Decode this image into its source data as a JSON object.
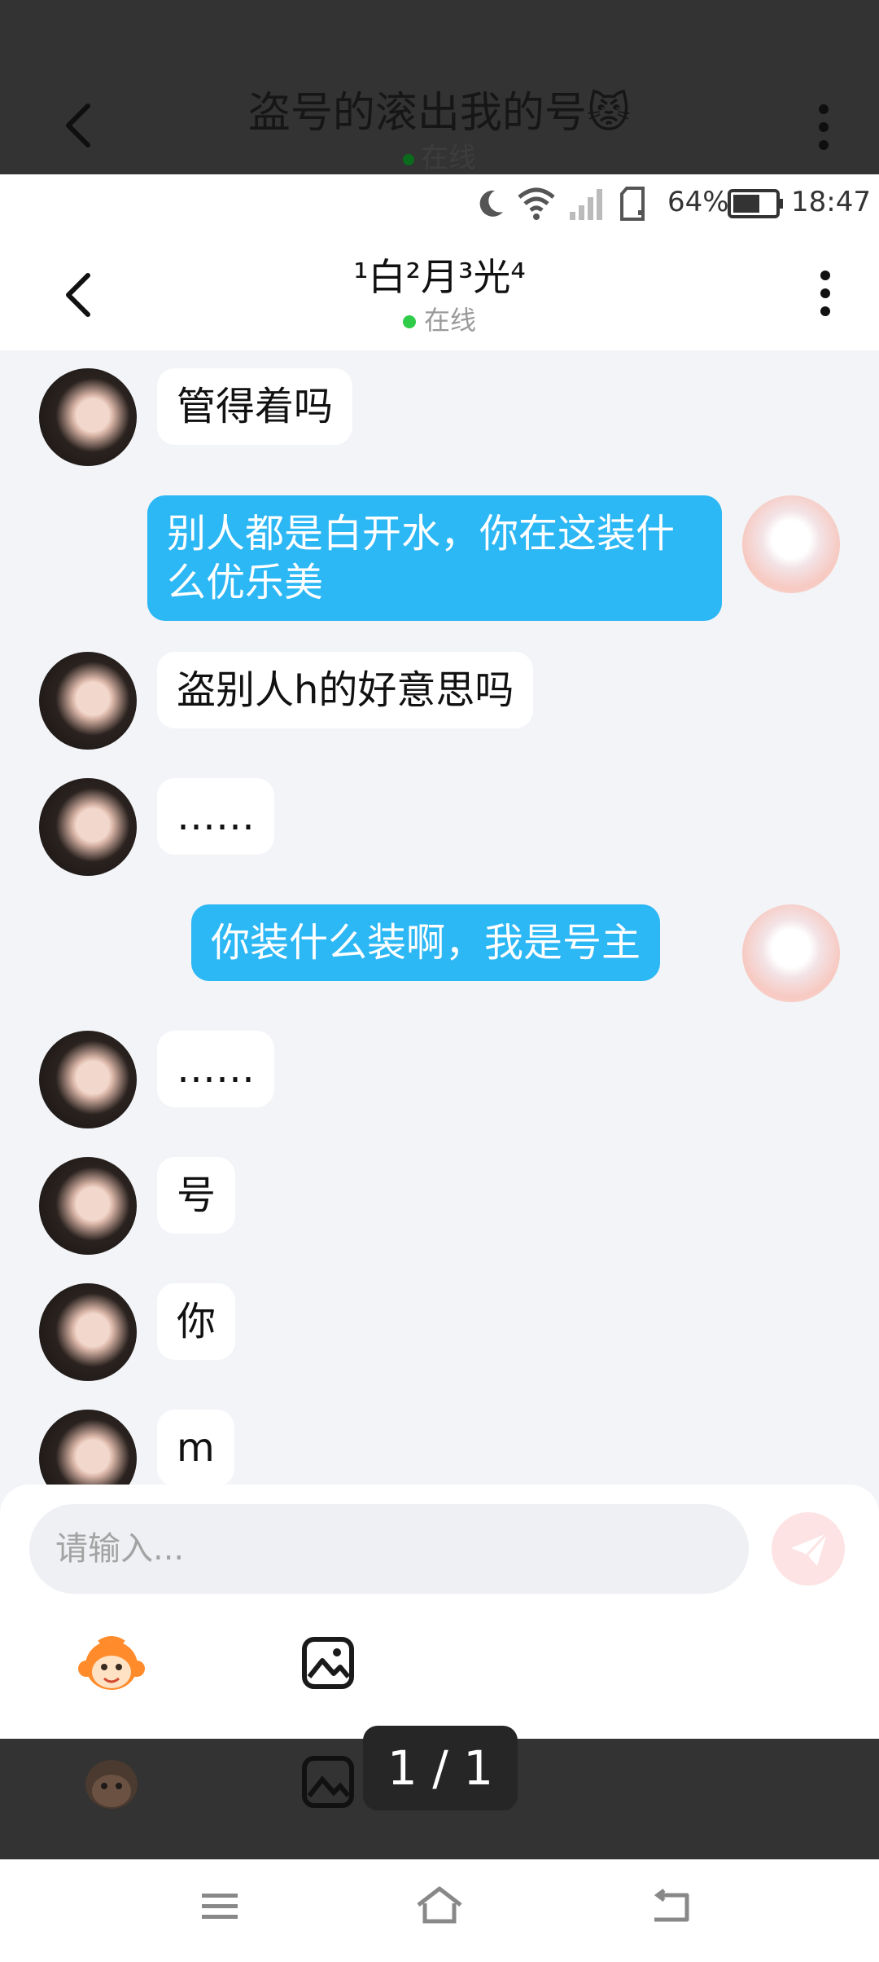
{
  "overlay": {
    "title": "盗号的滚出我的号😾",
    "status": "在线"
  },
  "status_bar": {
    "battery": "64%",
    "time": "18:47"
  },
  "header": {
    "title": "¹白²月³光⁴",
    "status": "在线"
  },
  "messages": [
    {
      "side": "in",
      "text": "管得着吗"
    },
    {
      "side": "out",
      "text": "别人都是白开水，你在这装什么优乐美"
    },
    {
      "side": "in",
      "text": "盗别人h的好意思吗"
    },
    {
      "side": "in",
      "text": "……"
    },
    {
      "side": "out",
      "text": "你装什么装啊，我是号主"
    },
    {
      "side": "in",
      "text": "……"
    },
    {
      "side": "in",
      "text": "号"
    },
    {
      "side": "in",
      "text": "你"
    },
    {
      "side": "in",
      "text": "m"
    }
  ],
  "input": {
    "placeholder": "请输入..."
  },
  "page_indicator": "1 / 1",
  "icons": {
    "back": "chevron-left-icon",
    "more": "more-vertical-icon",
    "moon": "moon-icon",
    "wifi": "wifi-icon",
    "signal": "signal-icon",
    "sim": "sim-icon",
    "battery": "battery-icon",
    "sticker": "monkey-sticker-icon",
    "image": "image-icon",
    "send": "send-icon",
    "menu": "menu-icon",
    "home": "home-icon",
    "nav_back": "back-icon"
  },
  "colors": {
    "accent_blue": "#2cb7f5",
    "online_green": "#2fcc49",
    "send_pink": "#fde3e3"
  }
}
